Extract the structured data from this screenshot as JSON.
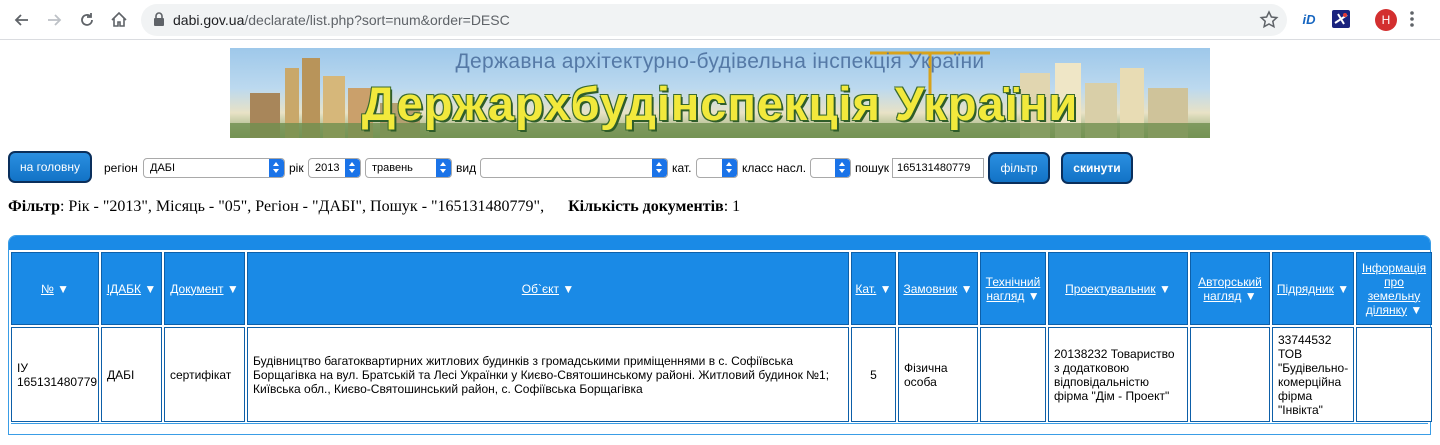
{
  "browser": {
    "url_host": "dabi.gov.ua",
    "url_path": "/declarate/list.php?sort=num&order=DESC",
    "ext_label": "iD",
    "avatar_letter": "H"
  },
  "banner": {
    "subtitle": "Державна архітектурно-будівельна інспекція України",
    "title": "Держархбудінспекція України"
  },
  "filters": {
    "home_button": "на головну",
    "region_label": "регіон",
    "region_value": "ДАБІ",
    "year_label": "рік",
    "year_value": "2013",
    "month_value": "травень",
    "type_label": "вид",
    "type_value": "",
    "cat_label": "кат.",
    "cat_value": "",
    "class_label": "класс насл.",
    "class_value": "",
    "search_label": "пошук",
    "search_value": "165131480779",
    "filter_button": "фільтр",
    "reset_button": "скинути"
  },
  "summary": {
    "filter_label": "Фільтр",
    "filter_text": ": Рік - \"2013\", Місяць - \"05\", Регіон - \"ДАБІ\", Пошук - \"165131480779\",",
    "count_label": "Кількість документів",
    "count_text": ": 1"
  },
  "table": {
    "headers": [
      {
        "label": "№"
      },
      {
        "label": "ІДАБК"
      },
      {
        "label": "Документ"
      },
      {
        "label": "Об`єкт"
      },
      {
        "label": "Кат."
      },
      {
        "label": "Замовник"
      },
      {
        "label": "Технічний нагляд"
      },
      {
        "label": "Проектувальник"
      },
      {
        "label": "Авторський нагляд"
      },
      {
        "label": "Підрядник"
      },
      {
        "label": "Інформація про земельну ділянку"
      }
    ],
    "rows": [
      {
        "num": "ІУ 165131480779",
        "idabk": "ДАБІ",
        "document": "сертифікат",
        "object": "Будівництво багатоквартирних житлових будинків з громадськими приміщеннями в с. Софіївська Борщагівка на вул. Братській та Лесі Українки у Києво-Святошинському районі. Житловий будинок №1; Київська обл., Києво-Святошинський район, с. Софіївська Борщагівка",
        "category": "5",
        "customer": "Фізична особа",
        "tech_supervision": "",
        "designer": "20138232 Товариство з додатковою відповідальністю фірма \"Дім - Проект\"",
        "author_supervision": "",
        "contractor": "33744532 ТОВ \"Будівельно-комерційна фірма \"Інвікта\"",
        "land_info": ""
      }
    ]
  },
  "colors": {
    "accent_blue": "#1a8ae6",
    "button_border": "#0a2f5c",
    "banner_title": "#f2e93c"
  }
}
